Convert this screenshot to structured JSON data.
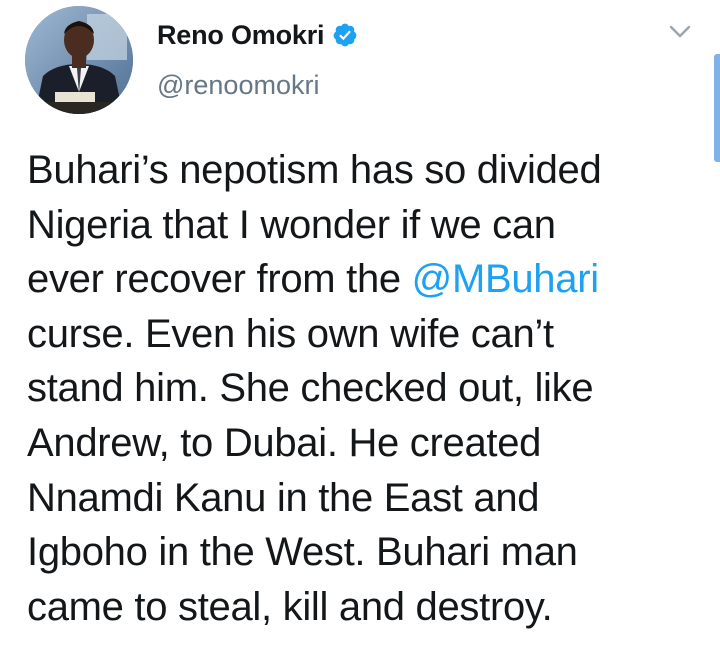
{
  "user": {
    "display_name": "Reno Omokri",
    "handle": "@renoomokri",
    "verified": true,
    "avatar_icon": "profile-photo"
  },
  "tweet": {
    "lines": [
      {
        "before": "Buhari’s nepotism has so divided",
        "mention": "",
        "after": ""
      },
      {
        "before": "Nigeria that I wonder if we can",
        "mention": "",
        "after": ""
      },
      {
        "before": "ever recover from the ",
        "mention": "@MBuhari",
        "after": ""
      },
      {
        "before": "curse. Even his own wife can’t",
        "mention": "",
        "after": ""
      },
      {
        "before": "stand him. She checked out, like",
        "mention": "",
        "after": ""
      },
      {
        "before": "Andrew, to Dubai. He created",
        "mention": "",
        "after": ""
      },
      {
        "before": "Nnamdi Kanu in the East and",
        "mention": "",
        "after": ""
      },
      {
        "before": "Igboho in the West. Buhari man",
        "mention": "",
        "after": ""
      },
      {
        "before": "came to steal, kill and destroy.",
        "mention": "",
        "after": ""
      }
    ]
  },
  "colors": {
    "text": "#14171a",
    "handle": "#657786",
    "link": "#1da1f2",
    "verified": "#1da1f2"
  },
  "icons": {
    "verified": "verified-badge-icon",
    "menu": "chevron-down-icon"
  }
}
